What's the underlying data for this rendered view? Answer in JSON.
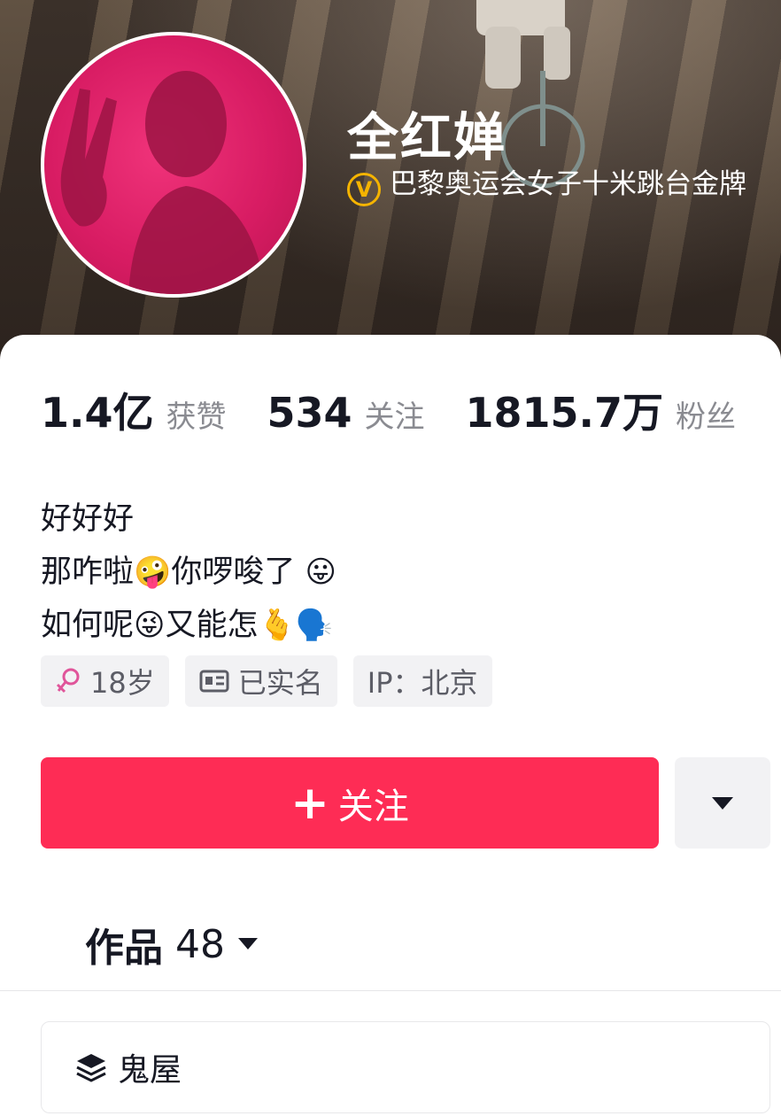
{
  "profile": {
    "name": "全红婵",
    "verification": "巴黎奥运会女子十米跳台金牌",
    "verify_badge": "V"
  },
  "stats": [
    {
      "value": "1.4亿",
      "label": "获赞"
    },
    {
      "value": "534",
      "label": "关注"
    },
    {
      "value": "1815.7万",
      "label": "粉丝"
    }
  ],
  "bio": {
    "line1": "好好好",
    "line2_a": "那咋啦",
    "line2_emoji1": "🤪",
    "line2_b": "你啰唆了 ",
    "line2_emoji2": "😛",
    "line3_a": "如何呢",
    "line3_emoji1": "😜",
    "line3_b": "又能怎",
    "line3_emoji2": "🫰",
    "line3_emoji3": "🗣️"
  },
  "tags": [
    {
      "icon": "female-icon",
      "label": "18岁"
    },
    {
      "icon": "id-card-icon",
      "label": "已实名"
    },
    {
      "icon": "",
      "label": "IP：北京"
    }
  ],
  "actions": {
    "follow_label": "关注",
    "follow_plus": "+"
  },
  "works": {
    "label": "作品",
    "count": "48"
  },
  "collection": {
    "label": "鬼屋"
  },
  "colors": {
    "accent": "#fe2c55",
    "verify": "#f5b400",
    "avatar_pink": "#e0226a"
  }
}
